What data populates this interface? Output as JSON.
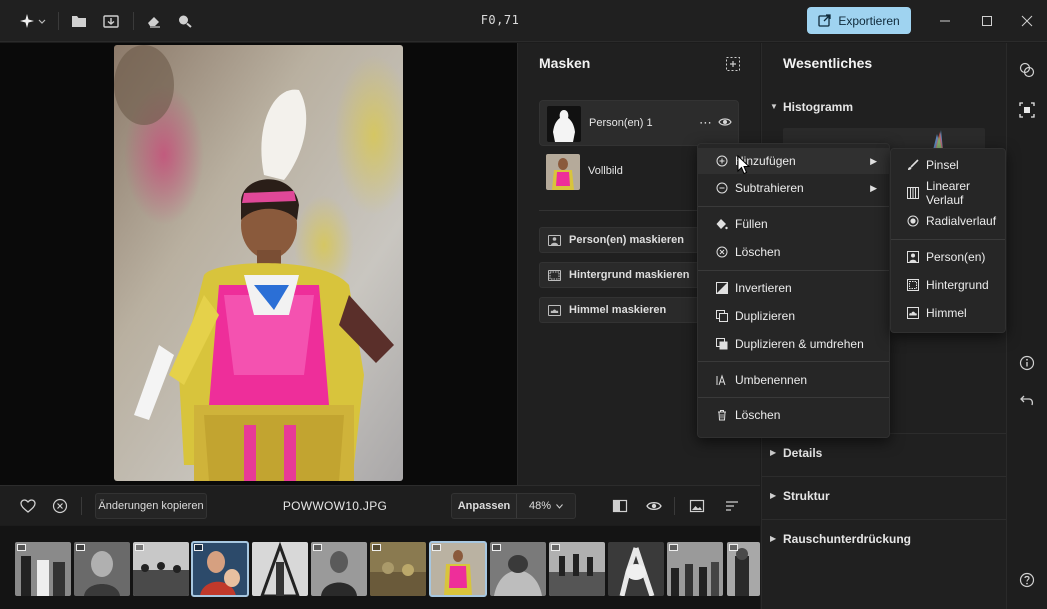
{
  "titlebar": {
    "file_label": "F0,71",
    "export_label": "Exportieren"
  },
  "masks_panel": {
    "title": "Masken",
    "items": [
      {
        "label": "Person(en) 1"
      },
      {
        "label": "Vollbild"
      }
    ],
    "buttons": [
      {
        "label": "Person(en) maskieren"
      },
      {
        "label": "Hintergrund maskieren"
      },
      {
        "label": "Himmel maskieren"
      }
    ]
  },
  "essentials_panel": {
    "title": "Wesentliches",
    "sections": [
      {
        "label": "Histogramm"
      },
      {
        "label": "Details"
      },
      {
        "label": "Struktur"
      },
      {
        "label": "Rauschunterdrückung"
      }
    ]
  },
  "bottom_bar": {
    "copy_changes_label": "Änderungen kopieren",
    "filename": "POWWOW10.JPG",
    "fit_label": "Anpassen",
    "zoom": "48%"
  },
  "context_menu": {
    "items": [
      {
        "label": "Hinzufügen",
        "has_submenu": true
      },
      {
        "label": "Subtrahieren",
        "has_submenu": true
      },
      {
        "label": "Füllen"
      },
      {
        "label": "Löschen"
      },
      {
        "label": "Invertieren"
      },
      {
        "label": "Duplizieren"
      },
      {
        "label": "Duplizieren & umdrehen"
      },
      {
        "label": "Umbenennen"
      },
      {
        "label": "Löschen"
      }
    ]
  },
  "submenu": {
    "items": [
      {
        "label": "Pinsel"
      },
      {
        "label": "Linearer Verlauf"
      },
      {
        "label": "Radialverlauf"
      },
      {
        "label": "Person(en)"
      },
      {
        "label": "Hintergrund"
      },
      {
        "label": "Himmel"
      }
    ]
  },
  "colors": {
    "accent": "#9fd3f0",
    "background": "#1c1c1c",
    "panel": "#202020",
    "menu": "#262626"
  }
}
